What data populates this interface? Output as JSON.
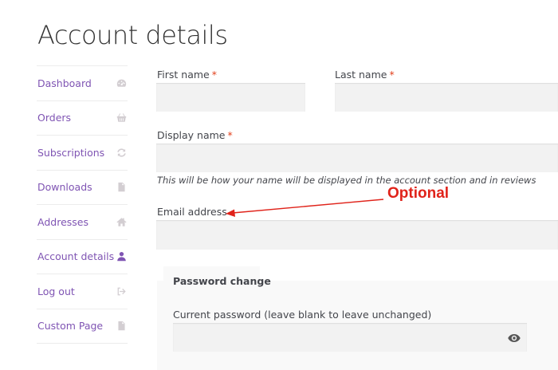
{
  "page": {
    "title": "Account details"
  },
  "sidebar": {
    "items": [
      {
        "label": "Dashboard",
        "icon": "dashboard-gauge-icon",
        "active": false
      },
      {
        "label": "Orders",
        "icon": "basket-icon",
        "active": false
      },
      {
        "label": "Subscriptions",
        "icon": "refresh-icon",
        "active": false
      },
      {
        "label": "Downloads",
        "icon": "file-icon",
        "active": false
      },
      {
        "label": "Addresses",
        "icon": "home-icon",
        "active": false
      },
      {
        "label": "Account details",
        "icon": "user-icon",
        "active": true
      },
      {
        "label": "Log out",
        "icon": "sign-out-icon",
        "active": false
      },
      {
        "label": "Custom Page",
        "icon": "file-text-icon",
        "active": false
      }
    ]
  },
  "form": {
    "first_name": {
      "label": "First name",
      "required": "*",
      "value": ""
    },
    "last_name": {
      "label": "Last name",
      "required": "*",
      "value": ""
    },
    "display_name": {
      "label": "Display name",
      "required": "*",
      "value": "",
      "hint": "This will be how your name will be displayed in the account section and in reviews"
    },
    "email": {
      "label": "Email address",
      "value": ""
    },
    "password_change": {
      "legend": "Password change",
      "current_password": {
        "label": "Current password (leave blank to leave unchanged)",
        "value": ""
      }
    }
  },
  "annotation": {
    "text": "Optional",
    "color": "#e0231a"
  },
  "colors": {
    "accent": "#7f54b3",
    "required": "#e2401c",
    "input_bg": "#f2f2f2"
  }
}
